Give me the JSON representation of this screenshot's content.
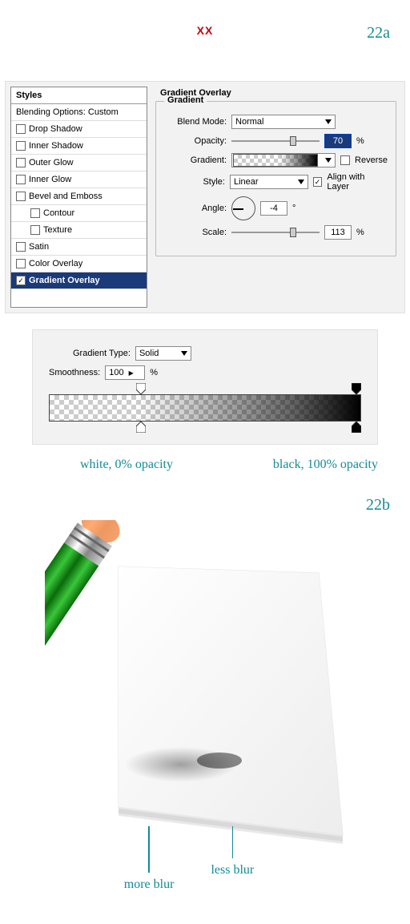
{
  "topMark": "XX",
  "stepA": "22a",
  "stepB": "22b",
  "styles": {
    "header": "Styles",
    "blendingOptions": "Blending Options: Custom",
    "dropShadow": "Drop Shadow",
    "innerShadow": "Inner Shadow",
    "outerGlow": "Outer Glow",
    "innerGlow": "Inner Glow",
    "bevel": "Bevel and Emboss",
    "contour": "Contour",
    "texture": "Texture",
    "satin": "Satin",
    "colorOverlay": "Color Overlay",
    "gradientOverlay": "Gradient Overlay"
  },
  "go": {
    "panelTitle": "Gradient Overlay",
    "legend": "Gradient",
    "blendModeLabel": "Blend Mode:",
    "blendModeValue": "Normal",
    "opacityLabel": "Opacity:",
    "opacityValue": "70",
    "opacityUnit": "%",
    "gradientLabel": "Gradient:",
    "reverseLabel": "Reverse",
    "styleLabel": "Style:",
    "styleValue": "Linear",
    "alignLabel": "Align with Layer",
    "angleLabel": "Angle:",
    "angleValue": "-4",
    "angleUnit": "°",
    "scaleLabel": "Scale:",
    "scaleValue": "113",
    "scaleUnit": "%"
  },
  "editor": {
    "typeLabel": "Gradient Type:",
    "typeValue": "Solid",
    "smoothLabel": "Smoothness:",
    "smoothValue": "100",
    "smoothUnit": "%"
  },
  "annotLeft": "white, 0% opacity",
  "annotRight": "black, 100% opacity",
  "annotMore": "more blur",
  "annotLess": "less blur"
}
